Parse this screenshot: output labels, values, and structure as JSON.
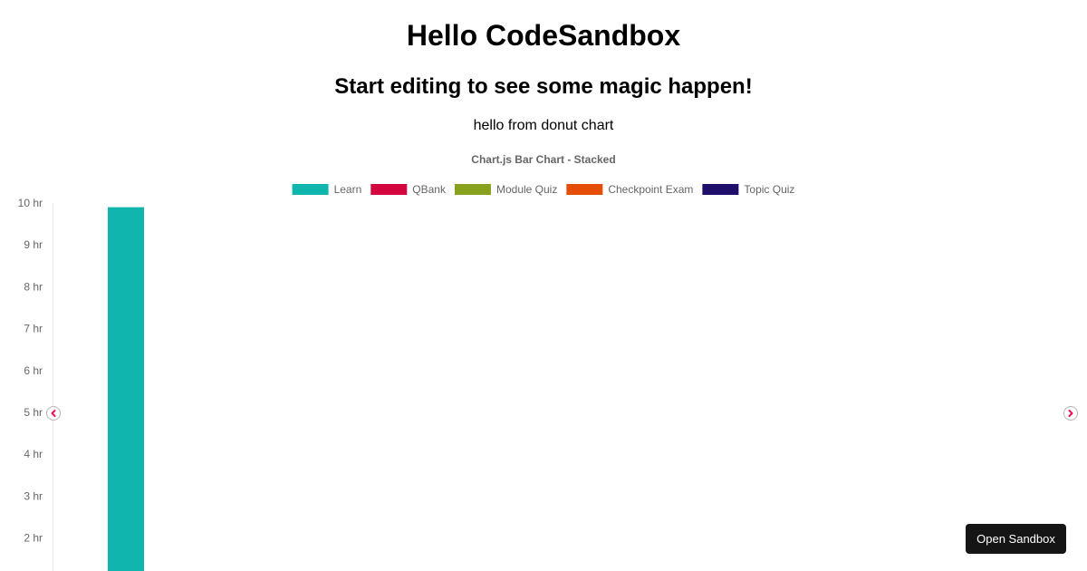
{
  "page": {
    "title": "Hello CodeSandbox",
    "subtitle": "Start editing to see some magic happen!",
    "caption": "hello from donut chart"
  },
  "open_sandbox_label": "Open Sandbox",
  "icons": {
    "prev": "chevron-left-icon",
    "next": "chevron-right-icon"
  },
  "chart_data": {
    "type": "bar",
    "stacked": true,
    "title": "Chart.js Bar Chart - Stacked",
    "legend_position": "top",
    "y_unit_suffix": " hr",
    "y_ticks": [
      2,
      3,
      4,
      5,
      6,
      7,
      8,
      9,
      10
    ],
    "ylim": [
      0,
      10
    ],
    "grid": false,
    "series": [
      {
        "name": "Learn",
        "color": "#10b5ae",
        "values": [
          9.9
        ]
      },
      {
        "name": "QBank",
        "color": "#d3073d",
        "values": [
          0
        ]
      },
      {
        "name": "Module Quiz",
        "color": "#88a11d",
        "values": [
          0
        ]
      },
      {
        "name": "Checkpoint Exam",
        "color": "#e44e08",
        "values": [
          0
        ]
      },
      {
        "name": "Topic Quiz",
        "color": "#1f0f6b",
        "values": [
          0
        ]
      }
    ]
  }
}
